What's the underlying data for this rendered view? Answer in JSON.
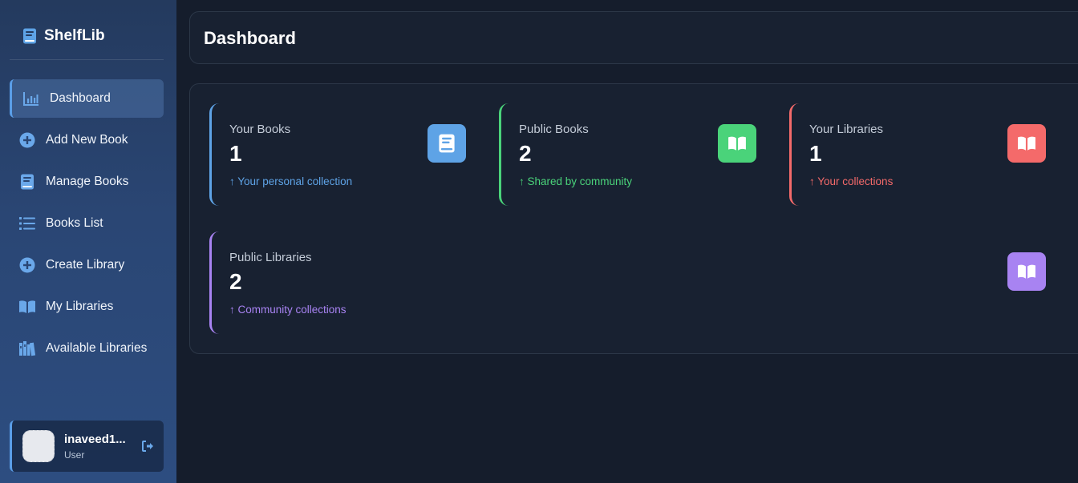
{
  "brand": {
    "name": "ShelfLib",
    "icon": "book-icon"
  },
  "sidebar": {
    "items": [
      {
        "label": "Dashboard",
        "icon": "chart-icon",
        "active": true
      },
      {
        "label": "Add New Book",
        "icon": "plus-circle-icon"
      },
      {
        "label": "Manage Books",
        "icon": "book-icon"
      },
      {
        "label": "Books List",
        "icon": "list-icon"
      },
      {
        "label": "Create Library",
        "icon": "plus-circle-icon"
      },
      {
        "label": "My Libraries",
        "icon": "open-book-icon"
      },
      {
        "label": "Available Libraries",
        "icon": "shelves-icon"
      }
    ]
  },
  "user": {
    "name": "inaveed1...",
    "role": "User"
  },
  "page": {
    "title": "Dashboard"
  },
  "stats": [
    {
      "title": "Your Books",
      "value": "1",
      "subtitle": "↑ Your personal collection",
      "color": "#5ea3e6",
      "icon": "book-icon"
    },
    {
      "title": "Public Books",
      "value": "2",
      "subtitle": "↑ Shared by community",
      "color": "#4ad37a",
      "icon": "open-book-icon"
    },
    {
      "title": "Your Libraries",
      "value": "1",
      "subtitle": "↑ Your collections",
      "color": "#f46a6a",
      "icon": "open-book-icon"
    },
    {
      "title": "Public Libraries",
      "value": "2",
      "subtitle": "↑ Community collections",
      "color": "#a883f2",
      "icon": "open-book-icon"
    }
  ]
}
